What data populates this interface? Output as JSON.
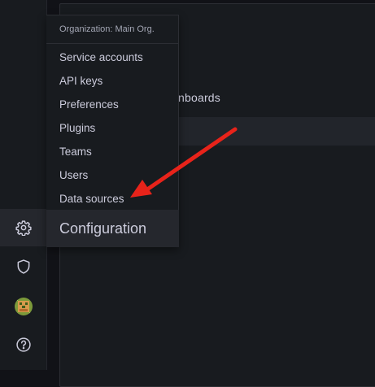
{
  "menu": {
    "header": "Organization: Main Org.",
    "items": [
      {
        "label": "Service accounts"
      },
      {
        "label": "API keys"
      },
      {
        "label": "Preferences"
      },
      {
        "label": "Plugins"
      },
      {
        "label": "Teams"
      },
      {
        "label": "Users"
      },
      {
        "label": "Data sources"
      }
    ],
    "footer_label": "Configuration"
  },
  "panel": {
    "partial_text": "nboards"
  },
  "sidebar": {
    "icons": [
      "gear-icon",
      "shield-icon",
      "avatar",
      "help-icon"
    ]
  },
  "colors": {
    "background": "#111217",
    "panel": "#181b1f",
    "text": "#ccccdc",
    "annotation_arrow": "#e8231a"
  }
}
